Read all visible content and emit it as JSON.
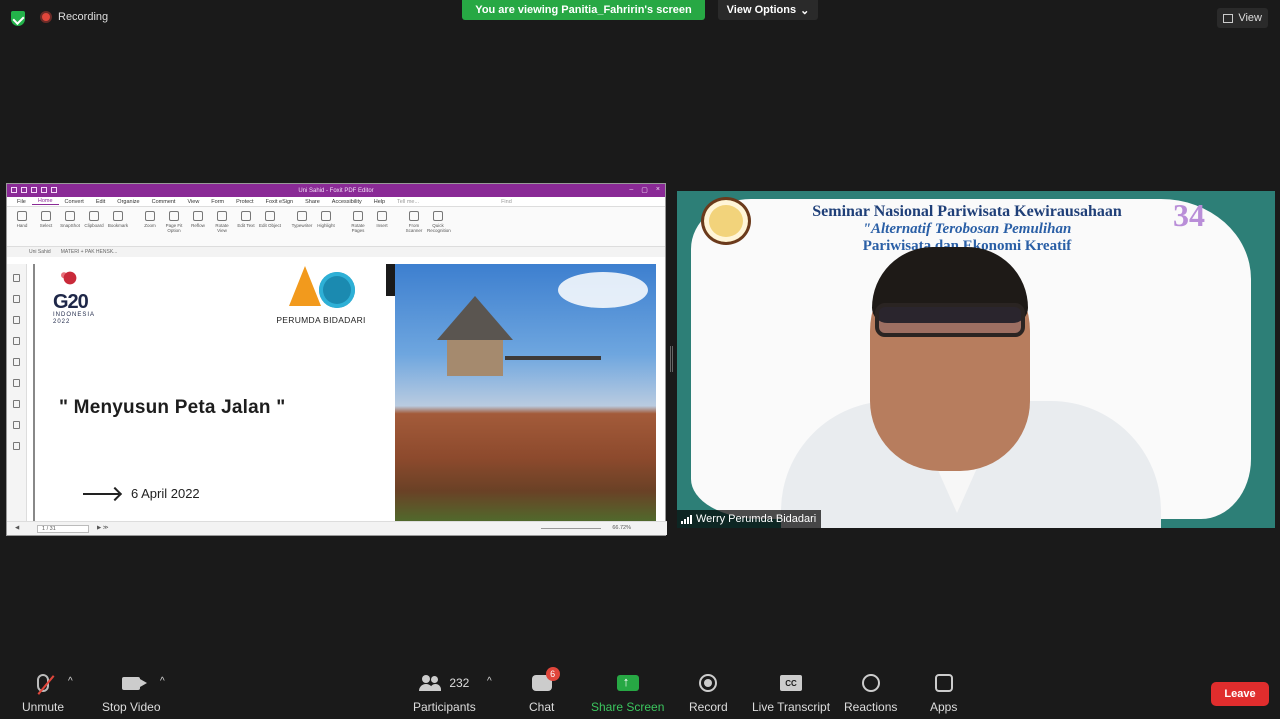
{
  "top": {
    "recording": "Recording",
    "viewing_banner": "You are viewing Panitia_Fahririn's screen",
    "view_options": "View Options",
    "view": "View"
  },
  "pdf": {
    "window_title": "Uni Sahid - Foxit PDF Editor",
    "menu": [
      "File",
      "Home",
      "Convert",
      "Edit",
      "Organize",
      "Comment",
      "View",
      "Form",
      "Protect",
      "Foxit eSign",
      "Share",
      "Accessibility",
      "Help"
    ],
    "tell_me": "Tell me...",
    "find": "Find",
    "ribbon": [
      "Hand",
      "Select",
      "SnapShot",
      "Clipboard",
      "Bookmark",
      "Zoom",
      "Page Fit Option",
      "Reflow",
      "Rotate View",
      "Edit Text",
      "Edit Object",
      "Typewriter",
      "Highlight",
      "Rotate Pages",
      "Insert",
      "From Scanner",
      "Quick Recognition"
    ],
    "tabs": [
      "Uni Sahid",
      "MATERI + PAK HENSK..."
    ],
    "page": "1 / 31",
    "zoom": "66.72%"
  },
  "slide": {
    "g20": "G20",
    "g20_sub1": "INDONESIA",
    "g20_sub2": "2022",
    "company": "PERUMDA BIDADARI",
    "title": "\" Menyusun Peta Jalan \"",
    "date": "6 April 2022"
  },
  "video": {
    "line1": "Seminar Nasional Pariwisata Kewirausahaan",
    "line2": "\"Alternatif Terobosan Pemulihan",
    "line3": "Pariwisata dan Ekonomi Kreatif",
    "line4": "\"",
    "logo": "34",
    "participant_name": "Werry Perumda Bidadari"
  },
  "toolbar": {
    "unmute": "Unmute",
    "stop_video": "Stop Video",
    "participants": "Participants",
    "participants_count": "232",
    "chat": "Chat",
    "chat_badge": "6",
    "share_screen": "Share Screen",
    "record": "Record",
    "live_transcript": "Live Transcript",
    "cc": "CC",
    "reactions": "Reactions",
    "apps": "Apps",
    "leave": "Leave"
  }
}
